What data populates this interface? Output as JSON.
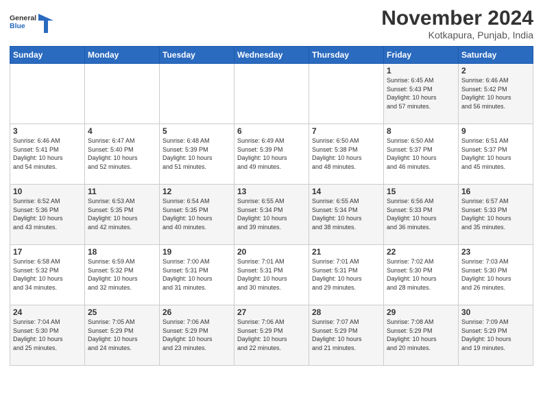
{
  "header": {
    "logo_general": "General",
    "logo_blue": "Blue",
    "month_title": "November 2024",
    "location": "Kotkapura, Punjab, India"
  },
  "days_of_week": [
    "Sunday",
    "Monday",
    "Tuesday",
    "Wednesday",
    "Thursday",
    "Friday",
    "Saturday"
  ],
  "weeks": [
    [
      {
        "day": "",
        "info": ""
      },
      {
        "day": "",
        "info": ""
      },
      {
        "day": "",
        "info": ""
      },
      {
        "day": "",
        "info": ""
      },
      {
        "day": "",
        "info": ""
      },
      {
        "day": "1",
        "info": "Sunrise: 6:45 AM\nSunset: 5:43 PM\nDaylight: 10 hours\nand 57 minutes."
      },
      {
        "day": "2",
        "info": "Sunrise: 6:46 AM\nSunset: 5:42 PM\nDaylight: 10 hours\nand 56 minutes."
      }
    ],
    [
      {
        "day": "3",
        "info": "Sunrise: 6:46 AM\nSunset: 5:41 PM\nDaylight: 10 hours\nand 54 minutes."
      },
      {
        "day": "4",
        "info": "Sunrise: 6:47 AM\nSunset: 5:40 PM\nDaylight: 10 hours\nand 52 minutes."
      },
      {
        "day": "5",
        "info": "Sunrise: 6:48 AM\nSunset: 5:39 PM\nDaylight: 10 hours\nand 51 minutes."
      },
      {
        "day": "6",
        "info": "Sunrise: 6:49 AM\nSunset: 5:39 PM\nDaylight: 10 hours\nand 49 minutes."
      },
      {
        "day": "7",
        "info": "Sunrise: 6:50 AM\nSunset: 5:38 PM\nDaylight: 10 hours\nand 48 minutes."
      },
      {
        "day": "8",
        "info": "Sunrise: 6:50 AM\nSunset: 5:37 PM\nDaylight: 10 hours\nand 46 minutes."
      },
      {
        "day": "9",
        "info": "Sunrise: 6:51 AM\nSunset: 5:37 PM\nDaylight: 10 hours\nand 45 minutes."
      }
    ],
    [
      {
        "day": "10",
        "info": "Sunrise: 6:52 AM\nSunset: 5:36 PM\nDaylight: 10 hours\nand 43 minutes."
      },
      {
        "day": "11",
        "info": "Sunrise: 6:53 AM\nSunset: 5:35 PM\nDaylight: 10 hours\nand 42 minutes."
      },
      {
        "day": "12",
        "info": "Sunrise: 6:54 AM\nSunset: 5:35 PM\nDaylight: 10 hours\nand 40 minutes."
      },
      {
        "day": "13",
        "info": "Sunrise: 6:55 AM\nSunset: 5:34 PM\nDaylight: 10 hours\nand 39 minutes."
      },
      {
        "day": "14",
        "info": "Sunrise: 6:55 AM\nSunset: 5:34 PM\nDaylight: 10 hours\nand 38 minutes."
      },
      {
        "day": "15",
        "info": "Sunrise: 6:56 AM\nSunset: 5:33 PM\nDaylight: 10 hours\nand 36 minutes."
      },
      {
        "day": "16",
        "info": "Sunrise: 6:57 AM\nSunset: 5:33 PM\nDaylight: 10 hours\nand 35 minutes."
      }
    ],
    [
      {
        "day": "17",
        "info": "Sunrise: 6:58 AM\nSunset: 5:32 PM\nDaylight: 10 hours\nand 34 minutes."
      },
      {
        "day": "18",
        "info": "Sunrise: 6:59 AM\nSunset: 5:32 PM\nDaylight: 10 hours\nand 32 minutes."
      },
      {
        "day": "19",
        "info": "Sunrise: 7:00 AM\nSunset: 5:31 PM\nDaylight: 10 hours\nand 31 minutes."
      },
      {
        "day": "20",
        "info": "Sunrise: 7:01 AM\nSunset: 5:31 PM\nDaylight: 10 hours\nand 30 minutes."
      },
      {
        "day": "21",
        "info": "Sunrise: 7:01 AM\nSunset: 5:31 PM\nDaylight: 10 hours\nand 29 minutes."
      },
      {
        "day": "22",
        "info": "Sunrise: 7:02 AM\nSunset: 5:30 PM\nDaylight: 10 hours\nand 28 minutes."
      },
      {
        "day": "23",
        "info": "Sunrise: 7:03 AM\nSunset: 5:30 PM\nDaylight: 10 hours\nand 26 minutes."
      }
    ],
    [
      {
        "day": "24",
        "info": "Sunrise: 7:04 AM\nSunset: 5:30 PM\nDaylight: 10 hours\nand 25 minutes."
      },
      {
        "day": "25",
        "info": "Sunrise: 7:05 AM\nSunset: 5:29 PM\nDaylight: 10 hours\nand 24 minutes."
      },
      {
        "day": "26",
        "info": "Sunrise: 7:06 AM\nSunset: 5:29 PM\nDaylight: 10 hours\nand 23 minutes."
      },
      {
        "day": "27",
        "info": "Sunrise: 7:06 AM\nSunset: 5:29 PM\nDaylight: 10 hours\nand 22 minutes."
      },
      {
        "day": "28",
        "info": "Sunrise: 7:07 AM\nSunset: 5:29 PM\nDaylight: 10 hours\nand 21 minutes."
      },
      {
        "day": "29",
        "info": "Sunrise: 7:08 AM\nSunset: 5:29 PM\nDaylight: 10 hours\nand 20 minutes."
      },
      {
        "day": "30",
        "info": "Sunrise: 7:09 AM\nSunset: 5:29 PM\nDaylight: 10 hours\nand 19 minutes."
      }
    ]
  ]
}
